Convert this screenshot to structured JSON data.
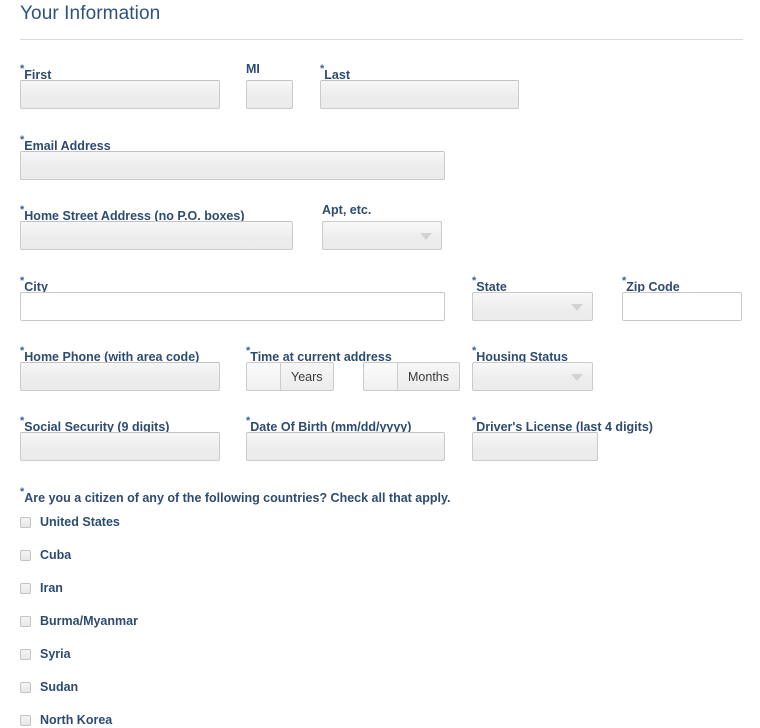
{
  "section": {
    "title": "Your Information"
  },
  "fields": {
    "first": {
      "label": "First",
      "required": true,
      "value": "",
      "style": "gray"
    },
    "mi": {
      "label": "MI",
      "required": false,
      "value": "",
      "style": "gray"
    },
    "last": {
      "label": "Last",
      "required": true,
      "value": "",
      "style": "gray"
    },
    "email": {
      "label": "Email Address",
      "required": true,
      "value": "",
      "style": "gray"
    },
    "street": {
      "label": "Home Street Address (no P.O. boxes)",
      "required": true,
      "value": "",
      "style": "gray"
    },
    "apt": {
      "label": "Apt, etc.",
      "required": false,
      "value": "",
      "control": "dropdown"
    },
    "city": {
      "label": "City",
      "required": true,
      "value": "",
      "style": "white"
    },
    "state": {
      "label": "State",
      "required": true,
      "value": "",
      "control": "dropdown"
    },
    "zip": {
      "label": "Zip Code",
      "required": true,
      "value": "",
      "style": "white"
    },
    "phone": {
      "label": "Home Phone (with area code)",
      "required": true,
      "value": "",
      "style": "gray"
    },
    "time_at_address": {
      "label": "Time at current address",
      "required": true,
      "years": {
        "value": "",
        "addon": "Years"
      },
      "months": {
        "value": "",
        "addon": "Months"
      }
    },
    "housing": {
      "label": "Housing Status",
      "required": true,
      "value": "",
      "control": "dropdown"
    },
    "ssn": {
      "label": "Social Security (9 digits)",
      "required": true,
      "value": "",
      "style": "gray"
    },
    "dob": {
      "label": "Date Of Birth (mm/dd/yyyy)",
      "required": true,
      "value": "",
      "style": "gray"
    },
    "license": {
      "label": "Driver's License (last 4 digits)",
      "required": true,
      "value": "",
      "style": "gray"
    }
  },
  "citizenship": {
    "question": "Are you a citizen of any of the following countries? Check all that apply.",
    "required": true,
    "options": [
      {
        "label": "United States",
        "checked": false
      },
      {
        "label": "Cuba",
        "checked": false
      },
      {
        "label": "Iran",
        "checked": false
      },
      {
        "label": "Burma/Myanmar",
        "checked": false
      },
      {
        "label": "Syria",
        "checked": false
      },
      {
        "label": "Sudan",
        "checked": false
      },
      {
        "label": "North Korea",
        "checked": false
      }
    ]
  },
  "required_marker": "*",
  "colors": {
    "label": "#2d4b72",
    "title": "#2d5282",
    "required_asterisk": "#3463a0",
    "field_border": "#cbcbcb",
    "divider": "#d9d9d9"
  }
}
